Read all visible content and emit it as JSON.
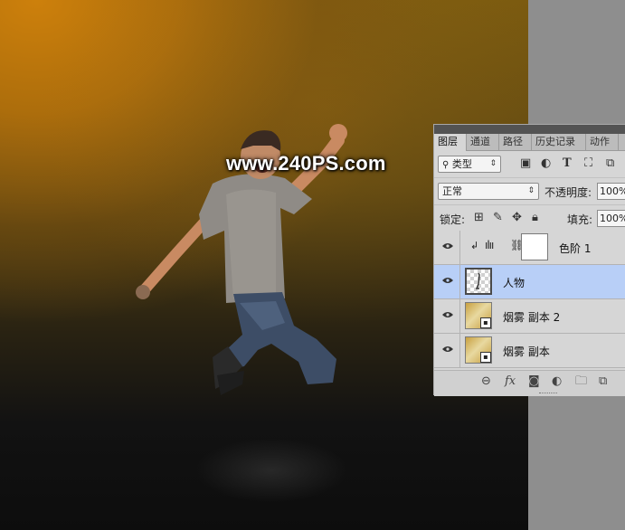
{
  "watermark": "www.240PS.com",
  "panel": {
    "tabs": [
      {
        "label": "图层",
        "active": true
      },
      {
        "label": "通道",
        "active": false
      },
      {
        "label": "路径",
        "active": false
      },
      {
        "label": "历史记录",
        "active": false
      },
      {
        "label": "动作",
        "active": false
      }
    ],
    "filter": {
      "kind_label": "类型",
      "icons": [
        "image-filter-icon",
        "adjustment-filter-icon",
        "type-filter-icon",
        "shape-filter-icon",
        "smart-object-filter-icon"
      ]
    },
    "blend_mode": "正常",
    "opacity_label": "不透明度:",
    "opacity_value": "100%",
    "lock_label": "锁定:",
    "fill_label": "填充:",
    "fill_value": "100%",
    "layers": [
      {
        "name": "色阶 1",
        "type": "adjustment-levels",
        "visible": true,
        "selected": false,
        "clipped": true
      },
      {
        "name": "人物",
        "type": "pixel",
        "visible": true,
        "selected": true
      },
      {
        "name": "烟雾 副本 2",
        "type": "smart-object",
        "visible": true,
        "selected": false
      },
      {
        "name": "烟雾 副本",
        "type": "smart-object",
        "visible": true,
        "selected": false
      }
    ],
    "bottom_icons": [
      "link-layers-icon",
      "fx-icon",
      "add-mask-icon",
      "new-adjustment-icon",
      "new-group-icon",
      "new-layer-icon"
    ],
    "fx_label": "fx"
  },
  "colors": {
    "panel_bg": "#d6d6d6",
    "selected_layer": "#b8cff7",
    "canvas_orange": "#cd800c",
    "canvas_dark": "#0d0d0d"
  }
}
